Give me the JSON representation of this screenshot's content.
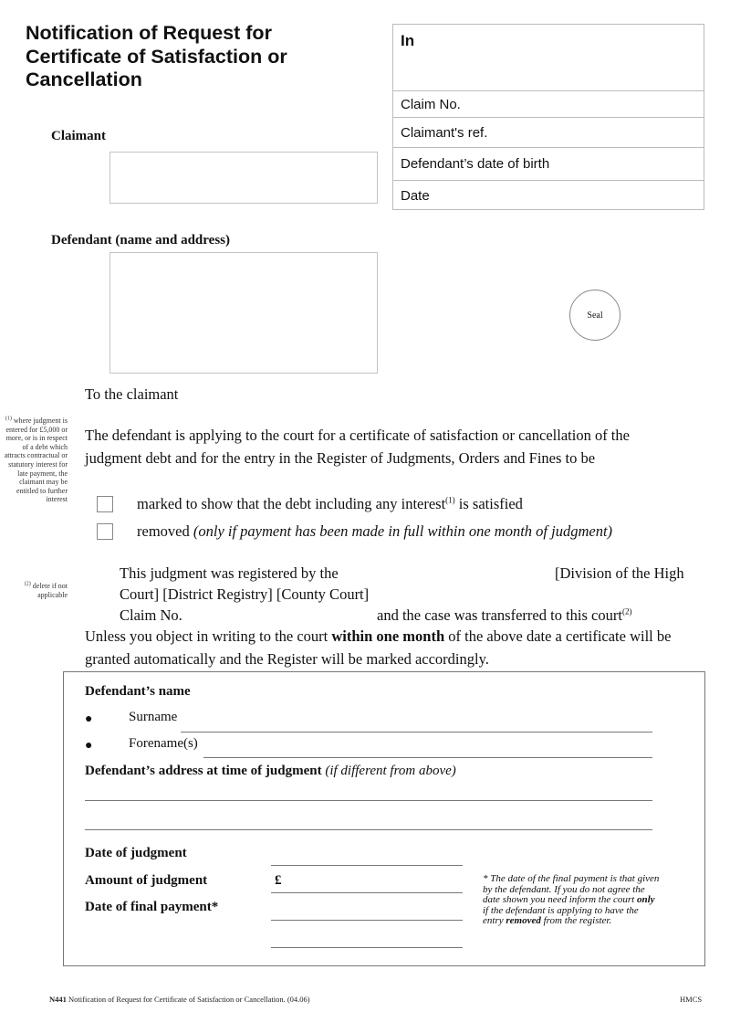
{
  "form": {
    "title": "Notification of Request for Certificate of Satisfaction or Cancellation",
    "title_lines": [
      "Notification of Request for",
      "Certificate of Satisfaction or",
      "Cancellation"
    ]
  },
  "infobox": {
    "in_label": "In",
    "rows": [
      {
        "label": "Claim No.",
        "value": ""
      },
      {
        "label": "Claimant's ref.",
        "value": ""
      },
      {
        "label": "Defendant’s date of birth",
        "value": ""
      },
      {
        "label": "Date",
        "value": ""
      }
    ]
  },
  "parties": {
    "claimant_label": "Claimant",
    "claimant_value": "",
    "defendant_label": "Defendant (name and address)",
    "defendant_value": ""
  },
  "seal_label": "Seal",
  "body": {
    "salutation": "To the claimant",
    "intro": "The defendant is applying to the court for a certificate of satisfaction or cancellation of the judgment debt and for the entry in the Register of Judgments, Orders and Fines to be",
    "options": [
      {
        "text_before": "marked to show that the debt including any interest",
        "sup": "(1)",
        "text_after": " is satisfied",
        "italic": "",
        "checked": false
      },
      {
        "text_before": "removed ",
        "sup": "",
        "text_after": "",
        "italic": "(only if payment has been made in full within one month of judgment)",
        "checked": false
      }
    ],
    "registered_prefix": "This judgment was registered by the",
    "registered_suffix": "[Division of the High",
    "registered_line2": "Court] [District Registry] [County Court]",
    "claim_no_label": "Claim No.",
    "transferred_text": "and the case was transferred to this court",
    "transferred_sup": "(2)",
    "objection_before": "Unless you object in writing to the court ",
    "objection_bold": "within one month",
    "objection_after": " of the above date a certificate will be granted automatically and the Register will be marked accordingly."
  },
  "margin_notes": {
    "note1_sup": "(1)",
    "note1": "where judgment is entered for £5,000 or more, or is in respect of a debt which attracts contractual or statutory interest for late payment, the claimant may be entitled to further interest",
    "note2_sup": "(2)",
    "note2": "delete if not applicable"
  },
  "panel": {
    "defendant_name_label": "Defendant’s name",
    "surname_label": "Surname",
    "surname_value": "",
    "forenames_label": "Forename(s)",
    "forenames_value": "",
    "address_label": "Defendant’s address at time of judgment ",
    "address_hint": "(if different from above)",
    "address_lines": [
      "",
      ""
    ],
    "date_of_judgment_label": "Date of judgment",
    "date_of_judgment_value": "",
    "amount_label": "Amount of judgment",
    "currency_symbol": "£",
    "amount_value": "",
    "final_payment_label": "Date of final payment*",
    "final_payment_value": "",
    "note_part1": "* The date of the final payment is that given by the defendant. If you do not agree the date shown you need inform the court ",
    "note_bold1": "only",
    "note_part2": " if the defendant is applying to have the entry ",
    "note_bold2": "removed",
    "note_part3": " from the register."
  },
  "footer": {
    "form_code": "N441",
    "form_desc": " Notification of Request for Certificate of Satisfaction or Cancellation. (04.06)",
    "issuer": "HMCS"
  }
}
